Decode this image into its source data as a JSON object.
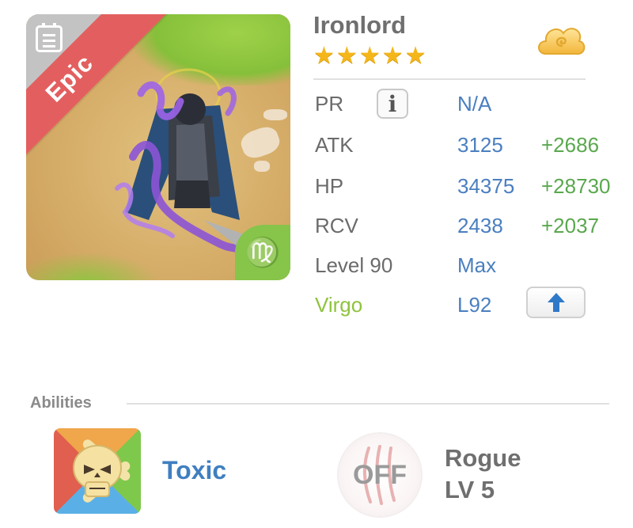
{
  "hero": {
    "name": "Ironlord",
    "rarity": "Epic",
    "stars": 5,
    "zodiac_symbol": "♍",
    "portrait_icon": "knight-with-purple-flames"
  },
  "stats": {
    "pr": {
      "label": "PR",
      "value": "N/A"
    },
    "atk": {
      "label": "ATK",
      "value": "3125",
      "bonus": "+2686"
    },
    "hp": {
      "label": "HP",
      "value": "34375",
      "bonus": "+28730"
    },
    "rcv": {
      "label": "RCV",
      "value": "2438",
      "bonus": "+2037"
    },
    "level": {
      "label": "Level 90",
      "value": "Max"
    },
    "sign": {
      "label": "Virgo",
      "value": "L92"
    }
  },
  "abilities": {
    "header": "Abilities",
    "skill": {
      "name": "Toxic",
      "icon": "skull-crossbones-icon"
    },
    "passive": {
      "status": "OFF",
      "name": "Rogue",
      "level": "LV 5",
      "icon": "claw-scratch-icon"
    }
  },
  "colors": {
    "epic_ribbon": "#e35f5f",
    "star": "#f5b61a",
    "stat_value": "#4a7fc0",
    "stat_bonus": "#5aa84e",
    "virgo": "#8fc33e",
    "ability_name": "#3f7fc0"
  }
}
